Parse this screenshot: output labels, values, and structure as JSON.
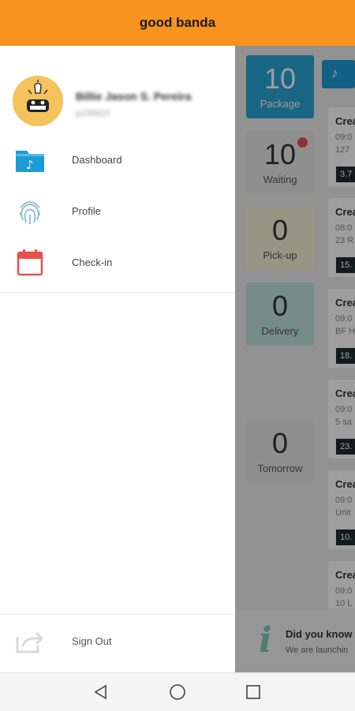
{
  "app": {
    "title": "good banda"
  },
  "user": {
    "name": "Billie Jason S. Pereira",
    "id": "p159923"
  },
  "drawer": {
    "items": [
      {
        "label": "Dashboard",
        "icon": "folder-music-icon"
      },
      {
        "label": "Profile",
        "icon": "fingerprint-icon"
      },
      {
        "label": "Check-in",
        "icon": "calendar-icon"
      }
    ],
    "sign_out": {
      "label": "Sign Out",
      "icon": "share-export-icon"
    }
  },
  "background": {
    "stats": [
      {
        "value": "10",
        "label": "Package",
        "color": "#29a3d6"
      },
      {
        "value": "10",
        "label": "Waiting",
        "color": "#e7e7e7",
        "notification_dot": true
      },
      {
        "value": "0",
        "label": "Pick-up",
        "color": "#f4f1d6"
      },
      {
        "value": "0",
        "label": "Delivery",
        "color": "#bfe3dc"
      },
      {
        "value": "0",
        "label": "Tomorrow",
        "color": "#e7e7e7"
      }
    ],
    "cards": [
      {
        "title": "Crea",
        "time": "09:0",
        "address": "127",
        "badge": "3.7"
      },
      {
        "title": "Crea",
        "time": "08:0",
        "address": "23 R",
        "badge": "15."
      },
      {
        "title": "Crea",
        "time": "09:0",
        "address": "BF H",
        "badge": "18."
      },
      {
        "title": "Crea",
        "time": "09:0",
        "address": "5 sa",
        "badge": "23."
      },
      {
        "title": "Crea",
        "time": "09:0",
        "address": "Unit",
        "badge": "10."
      },
      {
        "title": "Crea",
        "time": "09:0",
        "address": "10 L",
        "badge": ""
      }
    ],
    "banner": {
      "heading": "Did you know",
      "text": "We are launchin"
    }
  },
  "colors": {
    "appbar": "#f7931e",
    "accent_blue": "#1d9bd7",
    "calendar_red": "#e8504f"
  }
}
